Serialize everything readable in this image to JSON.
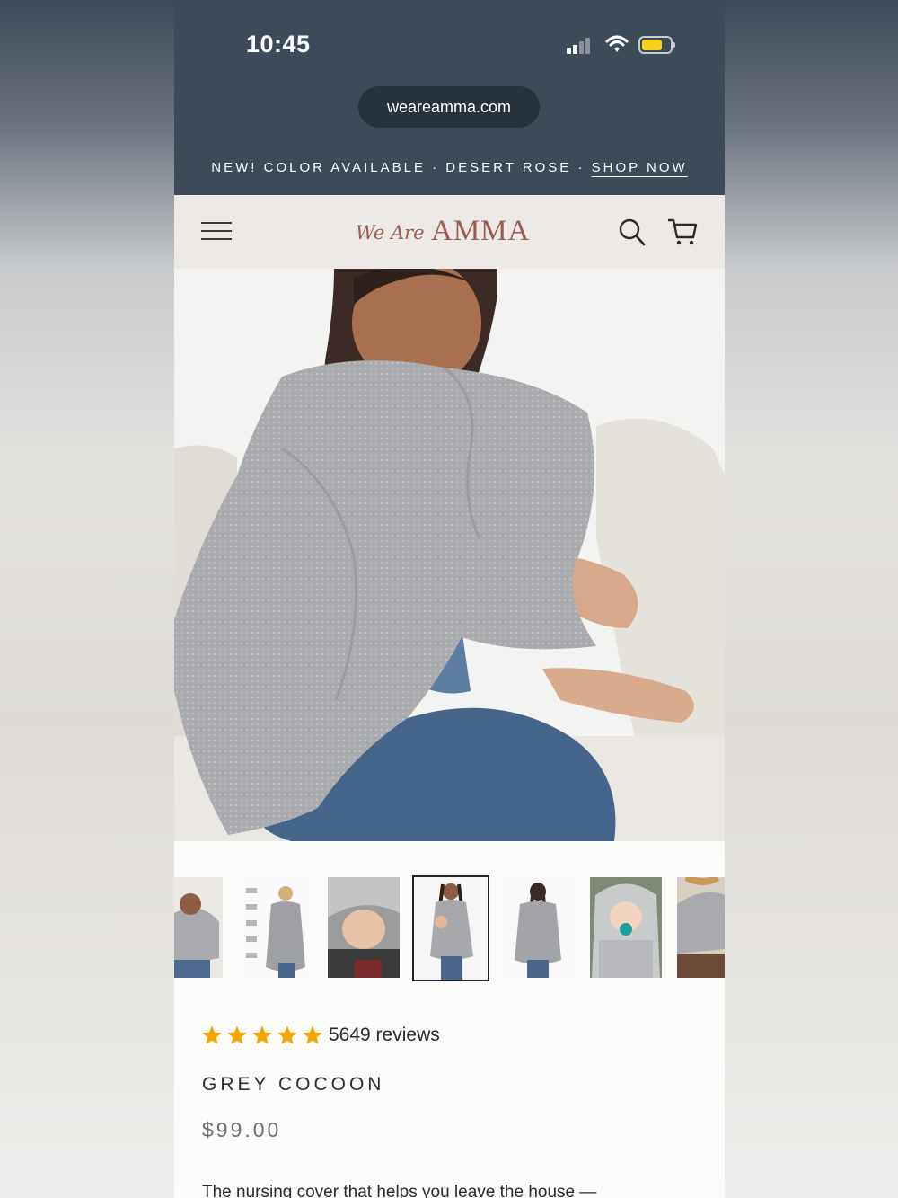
{
  "status_bar": {
    "time": "10:45"
  },
  "browser": {
    "url": "weareamma.com"
  },
  "promo_banner": {
    "text": "NEW! COLOR AVAILABLE · DESERT ROSE ·",
    "link": "SHOP NOW"
  },
  "header": {
    "logo_script": "We Are",
    "logo_brand": "AMMA",
    "icons": [
      "menu-icon",
      "search-icon",
      "cart-icon"
    ]
  },
  "gallery": {
    "thumbnail_count": 7,
    "selected_index": 3
  },
  "product": {
    "rating": 5,
    "reviews_text": "5649 reviews",
    "title": "GREY COCOON",
    "price": "$99.00",
    "description": "The nursing cover that helps you leave the house —"
  },
  "colors": {
    "chrome": "#3d4a57",
    "header_bg": "#ede9e6",
    "logo": "#9a5b55",
    "star": "#f5a300",
    "battery": "#f5d31c"
  }
}
